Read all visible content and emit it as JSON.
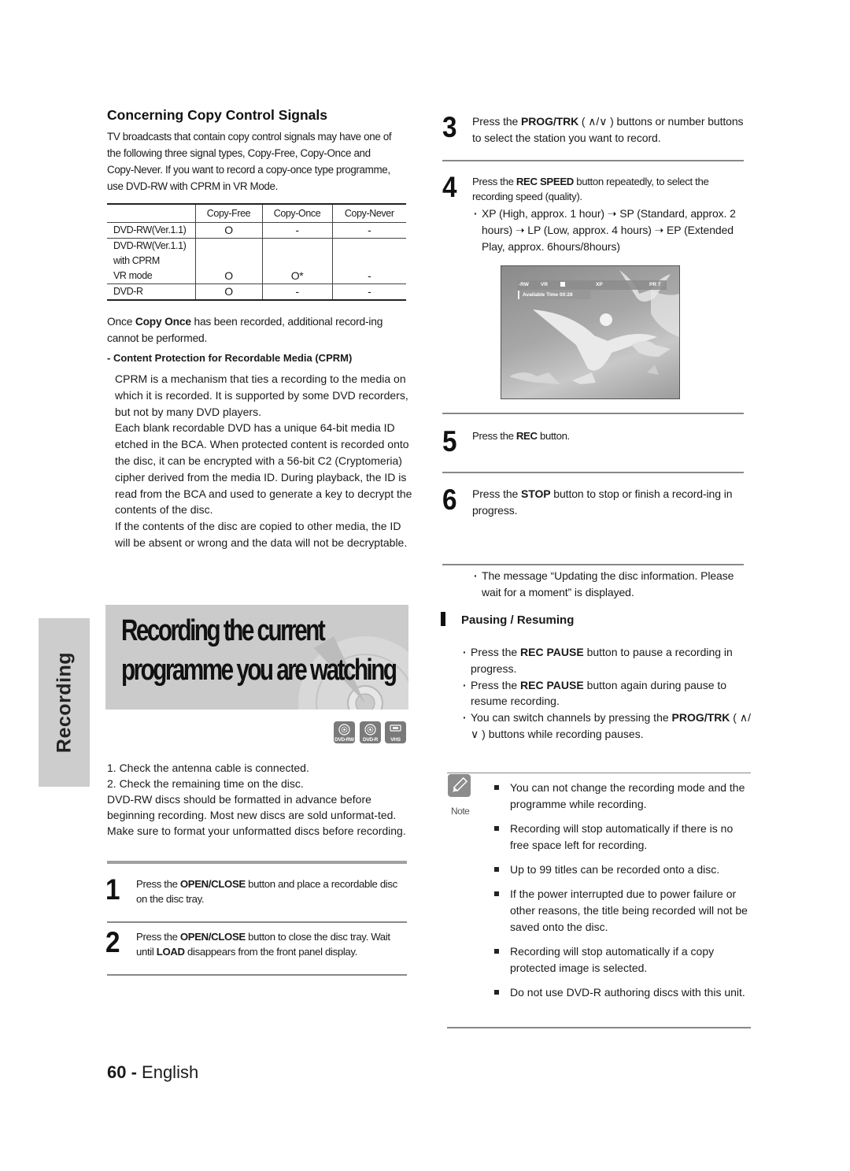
{
  "copy_control": {
    "title": "Concerning Copy Control Signals",
    "intro": "TV broadcasts that contain copy control signals may have one of the following three signal types, Copy-Free, Copy-Once and Copy-Never. If you want to record a copy-once type programme, use DVD-RW with CPRM in VR Mode.",
    "table": {
      "headers": [
        "",
        "Copy-Free",
        "Copy-Once",
        "Copy-Never"
      ],
      "rows": [
        {
          "media": [
            "DVD-RW(Ver.1.1)"
          ],
          "copy_free": "O",
          "copy_once": "-",
          "copy_never": "-"
        },
        {
          "media": [
            "DVD-RW(Ver.1.1)",
            "with CPRM",
            "VR mode"
          ],
          "copy_free": "O",
          "copy_once": "O*",
          "copy_never": "-"
        },
        {
          "media": [
            "DVD-R"
          ],
          "copy_free": "O",
          "copy_once": "-",
          "copy_never": "-"
        }
      ]
    },
    "once_note_pre": "Once ",
    "once_note_bold": "Copy Once",
    "once_note_post": " has been recorded, additional record-ing cannot be performed.",
    "cprm_heading": "- Content Protection for Recordable Media (CPRM)",
    "cprm_paragraphs": [
      "CPRM is a mechanism that ties a recording to the media on which it is recorded. It is supported by some DVD recorders, but not by many DVD players.",
      "Each blank recordable DVD has a unique 64-bit media ID etched in the BCA. When protected content is recorded onto the disc, it can be encrypted with a 56-bit C2 (Cryptomeria) cipher derived from the media ID. During playback, the ID is read from the BCA and used to generate a key to decrypt the contents of the disc.",
      "If the contents of the disc are copied to other media, the ID will be absent or wrong and the data will not be decryptable."
    ]
  },
  "side_tab": "Recording",
  "banner": {
    "line1": "Recording the current",
    "line2": "programme you are watching"
  },
  "media_icons": [
    {
      "icon": "dvd-rw-disc-icon",
      "label": "DVD-RW"
    },
    {
      "icon": "dvd-r-disc-icon",
      "label": "DVD-R"
    },
    {
      "icon": "vhs-cassette-icon",
      "label": "VHS"
    }
  ],
  "checks": [
    "1. Check the antenna cable is connected.",
    "2. Check the remaining time on the disc.",
    "DVD-RW discs should be formatted in advance before beginning recording. Most new discs are sold unformat-ted. Make sure to format your unformatted discs before recording."
  ],
  "steps": [
    {
      "num": "1",
      "parts": [
        [
          "Press the ",
          false
        ],
        [
          "OPEN/CLOSE",
          true
        ],
        [
          " button and place a recordable disc on the disc tray.",
          false
        ]
      ]
    },
    {
      "num": "2",
      "parts": [
        [
          "Press the ",
          false
        ],
        [
          "OPEN/CLOSE",
          true
        ],
        [
          " button to close the disc tray. Wait until ",
          false
        ],
        [
          "LOAD",
          true
        ],
        [
          " disappears from the front panel display.",
          false
        ]
      ]
    },
    {
      "num": "3",
      "parts": [
        [
          "Press the ",
          false
        ],
        [
          "PROG/TRK",
          true
        ],
        [
          " ( ∧/∨ ) buttons or number buttons to select the station you want to record.",
          false
        ]
      ]
    },
    {
      "num": "4",
      "parts": [
        [
          "Press the ",
          false
        ],
        [
          "REC SPEED",
          true
        ],
        [
          " button repeatedly, to select the recording speed (quality).",
          false
        ]
      ],
      "bullet": "XP (High, approx. 1 hour) ➝ SP (Standard, approx. 2 hours) ➝ LP (Low, approx. 4 hours) ➝ EP (Extended Play, approx. 6hours/8hours)"
    },
    {
      "num": "5",
      "parts": [
        [
          "Press the ",
          false
        ],
        [
          "REC",
          true
        ],
        [
          " button.",
          false
        ]
      ]
    },
    {
      "num": "6",
      "parts": [
        [
          "Press the ",
          false
        ],
        [
          "STOP",
          true
        ],
        [
          " button to stop or finish a record-ing in progress.",
          false
        ]
      ],
      "bullet": "The message “Updating the disc information. Please wait for a moment” is displayed."
    }
  ],
  "osd": {
    "disc": "-RW",
    "mode": "VR",
    "speed": "XP",
    "programme": "PR 7",
    "available_time": "Available Time 00:28"
  },
  "pausing": {
    "heading": "Pausing / Resuming",
    "items": [
      [
        [
          "Press the ",
          false
        ],
        [
          "REC PAUSE",
          true
        ],
        [
          " button to pause a recording in progress.",
          false
        ]
      ],
      [
        [
          "Press the ",
          false
        ],
        [
          "REC PAUSE",
          true
        ],
        [
          " button again during pause to resume recording.",
          false
        ]
      ],
      [
        [
          "You can switch channels by pressing the ",
          false
        ],
        [
          "PROG/TRK",
          true
        ],
        [
          " ( ∧/∨ ) buttons while recording pauses.",
          false
        ]
      ]
    ]
  },
  "note": {
    "label": "Note",
    "items": [
      "You can not change the recording mode and the programme while recording.",
      "Recording will stop automatically if there is no free space left for recording.",
      "Up to 99 titles can be recorded onto a disc.",
      "If the power interrupted due to power failure or other reasons, the title being recorded will not be saved onto the disc.",
      "Recording will stop automatically if a copy protected image is selected.",
      "Do not use DVD-R authoring discs with this unit."
    ]
  },
  "footer": {
    "page": "60 -",
    "language": " English"
  }
}
